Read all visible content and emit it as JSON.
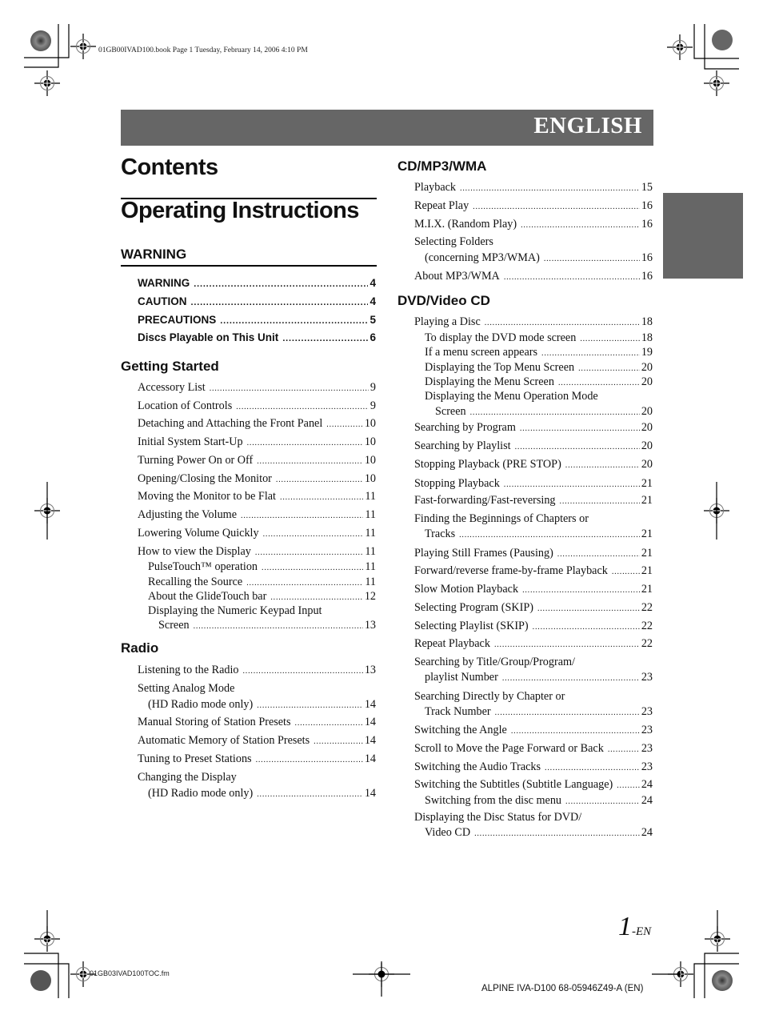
{
  "print_slug": {
    "top": "01GB00IVAD100.book  Page 1  Tuesday, February 14, 2006  4:10 PM",
    "bottom": "01GB03IVAD100TOC.fm"
  },
  "language_tab": "ENGLISH",
  "headings": {
    "contents": "Contents",
    "operating_instructions": "Operating Instructions"
  },
  "left_column": [
    {
      "title": "WARNING",
      "style": "bold",
      "entries": [
        {
          "text": "WARNING",
          "page": "4"
        },
        {
          "text": "CAUTION",
          "page": "4"
        },
        {
          "text": "PRECAUTIONS",
          "page": "5"
        },
        {
          "text": "Discs Playable on This Unit",
          "page": "6"
        }
      ]
    },
    {
      "title": "Getting Started",
      "entries": [
        {
          "text": "Accessory List",
          "page": "9"
        },
        {
          "text": "Location of Controls",
          "page": "9"
        },
        {
          "text": "Detaching and Attaching the Front Panel",
          "page": "10"
        },
        {
          "text": "Initial System Start-Up",
          "page": "10"
        },
        {
          "text": "Turning Power On or Off",
          "page": "10"
        },
        {
          "text": "Opening/Closing the Monitor",
          "page": "10"
        },
        {
          "text": "Moving the Monitor to be Flat",
          "page": "11"
        },
        {
          "text": "Adjusting the Volume",
          "page": "11"
        },
        {
          "text": "Lowering Volume Quickly",
          "page": "11"
        },
        {
          "text": "How to view the Display",
          "page": "11"
        },
        {
          "text": "PulseTouch™ operation",
          "page": "11",
          "level": 2
        },
        {
          "text": "Recalling the Source",
          "page": "11",
          "level": 2
        },
        {
          "text": "About the GlideTouch bar",
          "page": "12",
          "level": 2
        },
        {
          "text": "Displaying the Numeric Keypad Input",
          "continuation": "Screen",
          "page": "13",
          "level": 2
        }
      ]
    },
    {
      "title": "Radio",
      "entries": [
        {
          "text": "Listening to the Radio",
          "page": "13"
        },
        {
          "text": "Setting Analog Mode",
          "continuation": "(HD Radio mode only)",
          "page": "14"
        },
        {
          "text": "Manual Storing of Station Presets",
          "page": "14"
        },
        {
          "text": "Automatic Memory of Station Presets",
          "page": "14"
        },
        {
          "text": "Tuning to Preset Stations",
          "page": "14"
        },
        {
          "text": "Changing the Display",
          "continuation": "(HD Radio mode only)",
          "page": "14"
        }
      ]
    }
  ],
  "right_column": [
    {
      "title": "CD/MP3/WMA",
      "entries": [
        {
          "text": "Playback",
          "page": "15"
        },
        {
          "text": "Repeat Play",
          "page": "16"
        },
        {
          "text": "M.I.X. (Random Play)",
          "page": "16"
        },
        {
          "text": "Selecting Folders",
          "continuation": "(concerning MP3/WMA)",
          "page": "16"
        },
        {
          "text": "About MP3/WMA",
          "page": "16"
        }
      ]
    },
    {
      "title": "DVD/Video CD",
      "entries": [
        {
          "text": "Playing a Disc",
          "page": "18"
        },
        {
          "text": "To display the DVD mode screen",
          "page": "18",
          "level": 2
        },
        {
          "text": "If a menu screen appears",
          "page": "19",
          "level": 2
        },
        {
          "text": "Displaying the Top Menu Screen",
          "page": "20",
          "level": 2
        },
        {
          "text": "Displaying the Menu Screen",
          "page": "20",
          "level": 2
        },
        {
          "text": "Displaying the Menu Operation Mode",
          "continuation": "Screen",
          "page": "20",
          "level": 2
        },
        {
          "text": "Searching by Program",
          "page": "20"
        },
        {
          "text": "Searching by Playlist",
          "page": "20"
        },
        {
          "text": "Stopping Playback (PRE STOP)",
          "page": "20"
        },
        {
          "text": "Stopping Playback",
          "page": "21"
        },
        {
          "text": "Fast-forwarding/Fast-reversing",
          "page": "21"
        },
        {
          "text": "Finding the Beginnings of Chapters or",
          "continuation": "Tracks",
          "page": "21"
        },
        {
          "text": "Playing Still Frames (Pausing)",
          "page": "21"
        },
        {
          "text": "Forward/reverse frame-by-frame Playback",
          "page": "21"
        },
        {
          "text": "Slow Motion Playback",
          "page": "21"
        },
        {
          "text": "Selecting Program (SKIP)",
          "page": "22"
        },
        {
          "text": "Selecting Playlist (SKIP)",
          "page": "22"
        },
        {
          "text": "Repeat Playback",
          "page": "22"
        },
        {
          "text": "Searching by Title/Group/Program/",
          "continuation": "playlist Number",
          "page": "23"
        },
        {
          "text": "Searching Directly by Chapter or",
          "continuation": "Track Number",
          "page": "23"
        },
        {
          "text": "Switching the Angle",
          "page": "23"
        },
        {
          "text": "Scroll to Move the Page Forward or Back",
          "page": "23"
        },
        {
          "text": "Switching the Audio Tracks",
          "page": "23"
        },
        {
          "text": "Switching the Subtitles (Subtitle Language)",
          "page": "24"
        },
        {
          "text": "Switching from the disc menu",
          "page": "24",
          "level": 2
        },
        {
          "text": "Displaying the Disc Status for DVD/",
          "continuation": "Video CD",
          "page": "24"
        }
      ]
    }
  ],
  "page_number": {
    "number": "1",
    "suffix": "-EN"
  },
  "footer_code": "ALPINE IVA-D100 68-05946Z49-A (EN)",
  "icons": {
    "registration_mark": "crosshair-circle-icon",
    "color_target": "starburst-target-icon",
    "crop_mark": "crop-mark-icon"
  }
}
